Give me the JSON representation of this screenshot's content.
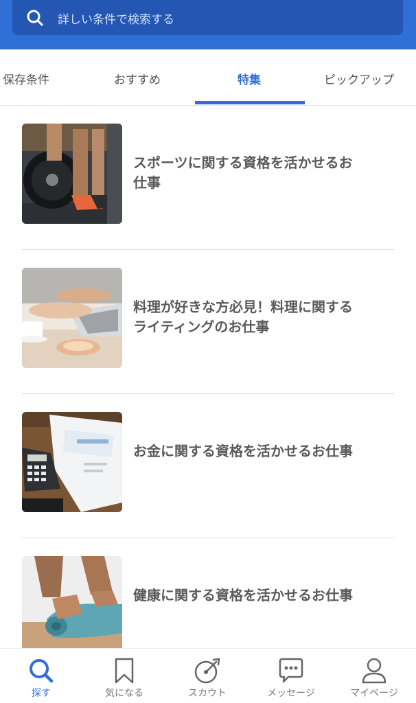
{
  "search": {
    "placeholder": "詳しい条件で検索する"
  },
  "tabs": [
    {
      "label": "保存条件"
    },
    {
      "label": "おすすめ"
    },
    {
      "label": "特集"
    },
    {
      "label": "ピックアップ"
    }
  ],
  "active_tab": "特集",
  "items": [
    {
      "title": "スポーツに関する資格を活かせるお仕事",
      "thumb": "sports-training-photo"
    },
    {
      "title": "料理が好きな方必見！料理に関するライティングのお仕事",
      "thumb": "laptop-and-coffee-photo"
    },
    {
      "title": "お金に関する資格を活かせるお仕事",
      "thumb": "calculator-and-documents-photo"
    },
    {
      "title": "健康に関する資格を活かせるお仕事",
      "thumb": "yoga-mat-photo"
    }
  ],
  "bottom_nav": [
    {
      "label": "探す",
      "icon": "search-icon"
    },
    {
      "label": "気になる",
      "icon": "bookmark-icon"
    },
    {
      "label": "スカウト",
      "icon": "scout-target-icon"
    },
    {
      "label": "メッセージ",
      "icon": "message-icon"
    },
    {
      "label": "マイページ",
      "icon": "user-icon"
    }
  ],
  "colors": {
    "accent": "#2f6fd6",
    "header": "#2f6fd6",
    "search_box": "#2456b3"
  }
}
